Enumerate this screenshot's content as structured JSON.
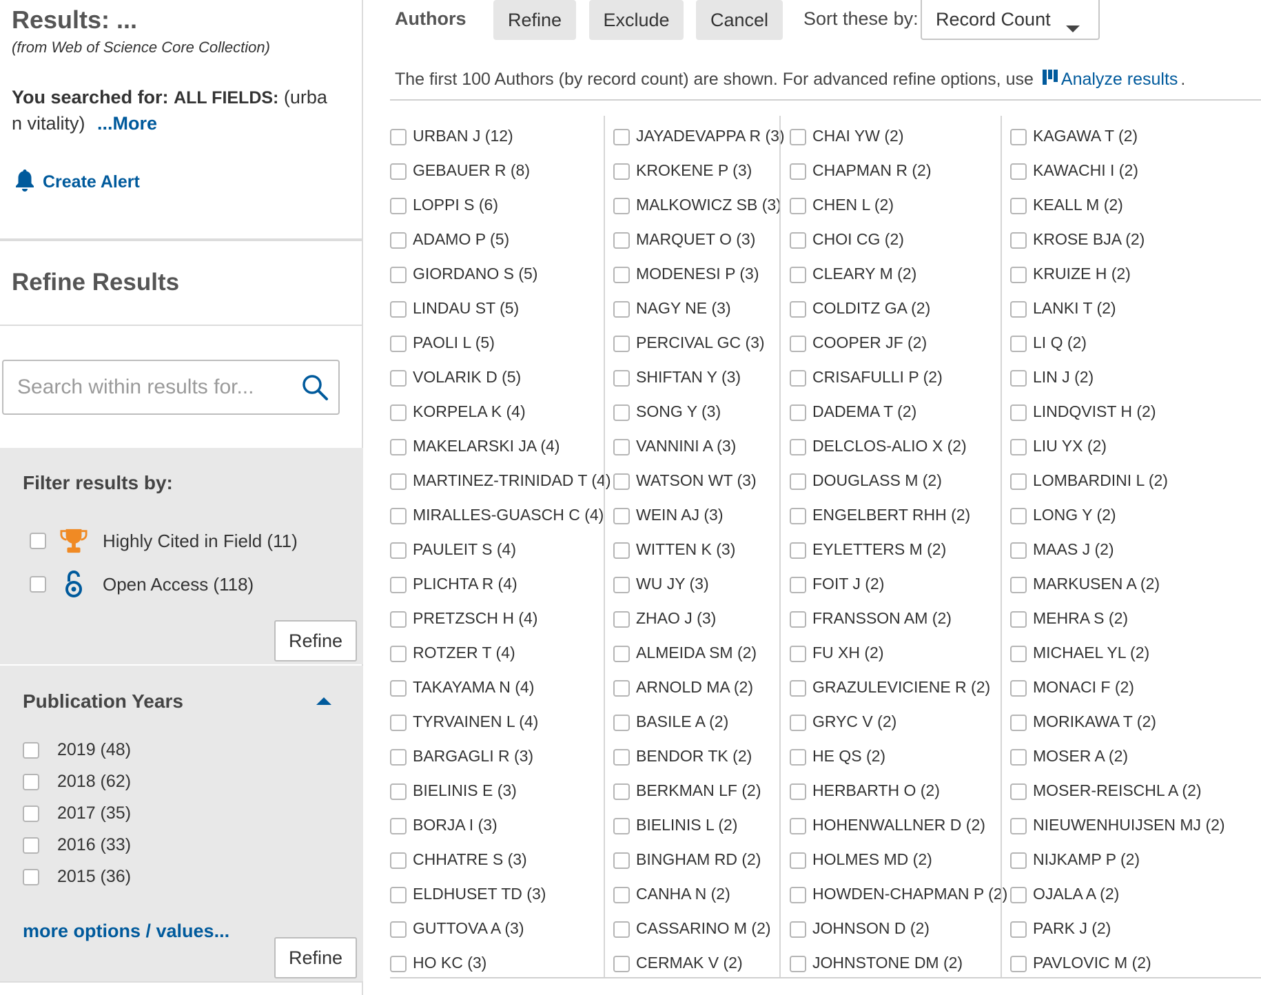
{
  "sidebar": {
    "results_title": "Results: ...",
    "results_source": "(from Web of Science Core Collection)",
    "searched_label": "You searched for:",
    "searched_field": "ALL FIELDS:",
    "searched_query_line1": "(urba",
    "searched_query_line2": "n vitality)",
    "more_link": "...More",
    "create_alert": "Create Alert",
    "refine_heading": "Refine Results",
    "search_placeholder": "Search within results for...",
    "filter_title": "Filter results by:",
    "filters": [
      {
        "label": "Highly Cited in Field (11)",
        "icon": "trophy-icon"
      },
      {
        "label": "Open Access (118)",
        "icon": "open-access-icon"
      }
    ],
    "refine_button": "Refine",
    "pub_years_title": "Publication Years",
    "years": [
      "2019 (48)",
      "2018 (62)",
      "2017 (35)",
      "2016 (33)",
      "2015 (36)"
    ],
    "more_options": "more options / values...",
    "refine_button_2": "Refine"
  },
  "toolbar": {
    "label": "Authors",
    "refine": "Refine",
    "exclude": "Exclude",
    "cancel": "Cancel",
    "sort_label": "Sort these by:",
    "sort_value": "Record Count"
  },
  "info": {
    "text": "The first 100 Authors (by record count) are shown. For advanced refine options, use",
    "analyze_link": "Analyze results",
    "trailing": "."
  },
  "colors": {
    "link": "#005a9c",
    "trophy": "#f08a24",
    "panel_bg": "#e8e8e8",
    "button_bg": "#e6e6e6"
  },
  "authors": [
    [
      "URBAN J (12)",
      "GEBAUER R (8)",
      "LOPPI S (6)",
      "ADAMO P (5)",
      "GIORDANO S (5)",
      "LINDAU ST (5)",
      "PAOLI L (5)",
      "VOLARIK D (5)",
      "KORPELA K (4)",
      "MAKELARSKI JA (4)",
      "MARTINEZ-TRINIDAD T (4)",
      "MIRALLES-GUASCH C (4)",
      "PAULEIT S (4)",
      "PLICHTA R (4)",
      "PRETZSCH H (4)",
      "ROTZER T (4)",
      "TAKAYAMA N (4)",
      "TYRVAINEN L (4)",
      "BARGAGLI R (3)",
      "BIELINIS E (3)",
      "BORJA I (3)",
      "CHHATRE S (3)",
      "ELDHUSET TD (3)",
      "GUTTOVA A (3)",
      "HO KC (3)"
    ],
    [
      "JAYADEVAPPA R (3)",
      "KROKENE P (3)",
      "MALKOWICZ SB (3)",
      "MARQUET O (3)",
      "MODENESI P (3)",
      "NAGY NE (3)",
      "PERCIVAL GC (3)",
      "SHIFTAN Y (3)",
      "SONG Y (3)",
      "VANNINI A (3)",
      "WATSON WT (3)",
      "WEIN AJ (3)",
      "WITTEN K (3)",
      "WU JY (3)",
      "ZHAO J (3)",
      "ALMEIDA SM (2)",
      "ARNOLD MA (2)",
      "BASILE A (2)",
      "BENDOR TK (2)",
      "BERKMAN LF (2)",
      "BIELINIS L (2)",
      "BINGHAM RD (2)",
      "CANHA N (2)",
      "CASSARINO M (2)",
      "CERMAK V (2)"
    ],
    [
      "CHAI YW (2)",
      "CHAPMAN R (2)",
      "CHEN L (2)",
      "CHOI CG (2)",
      "CLEARY M (2)",
      "COLDITZ GA (2)",
      "COOPER JF (2)",
      "CRISAFULLI P (2)",
      "DADEMA T (2)",
      "DELCLOS-ALIO X (2)",
      "DOUGLASS M (2)",
      "ENGELBERT RHH (2)",
      "EYLETTERS M (2)",
      "FOIT J (2)",
      "FRANSSON AM (2)",
      "FU XH (2)",
      "GRAZULEVICIENE R (2)",
      "GRYC V (2)",
      "HE QS (2)",
      "HERBARTH O (2)",
      "HOHENWALLNER D (2)",
      "HOLMES MD (2)",
      "HOWDEN-CHAPMAN P (2)",
      "JOHNSON D (2)",
      "JOHNSTONE DM (2)"
    ],
    [
      "KAGAWA T (2)",
      "KAWACHI I (2)",
      "KEALL M (2)",
      "KROSE BJA (2)",
      "KRUIZE H (2)",
      "LANKI T (2)",
      "LI Q (2)",
      "LIN J (2)",
      "LINDQVIST H (2)",
      "LIU YX (2)",
      "LOMBARDINI L (2)",
      "LONG Y (2)",
      "MAAS J (2)",
      "MARKUSEN A (2)",
      "MEHRA S (2)",
      "MICHAEL YL (2)",
      "MONACI F (2)",
      "MORIKAWA T (2)",
      "MOSER A (2)",
      "MOSER-REISCHL A (2)",
      "NIEUWENHUIJSEN MJ (2)",
      "NIJKAMP P (2)",
      "OJALA A (2)",
      "PARK J (2)",
      "PAVLOVIC M (2)"
    ]
  ]
}
